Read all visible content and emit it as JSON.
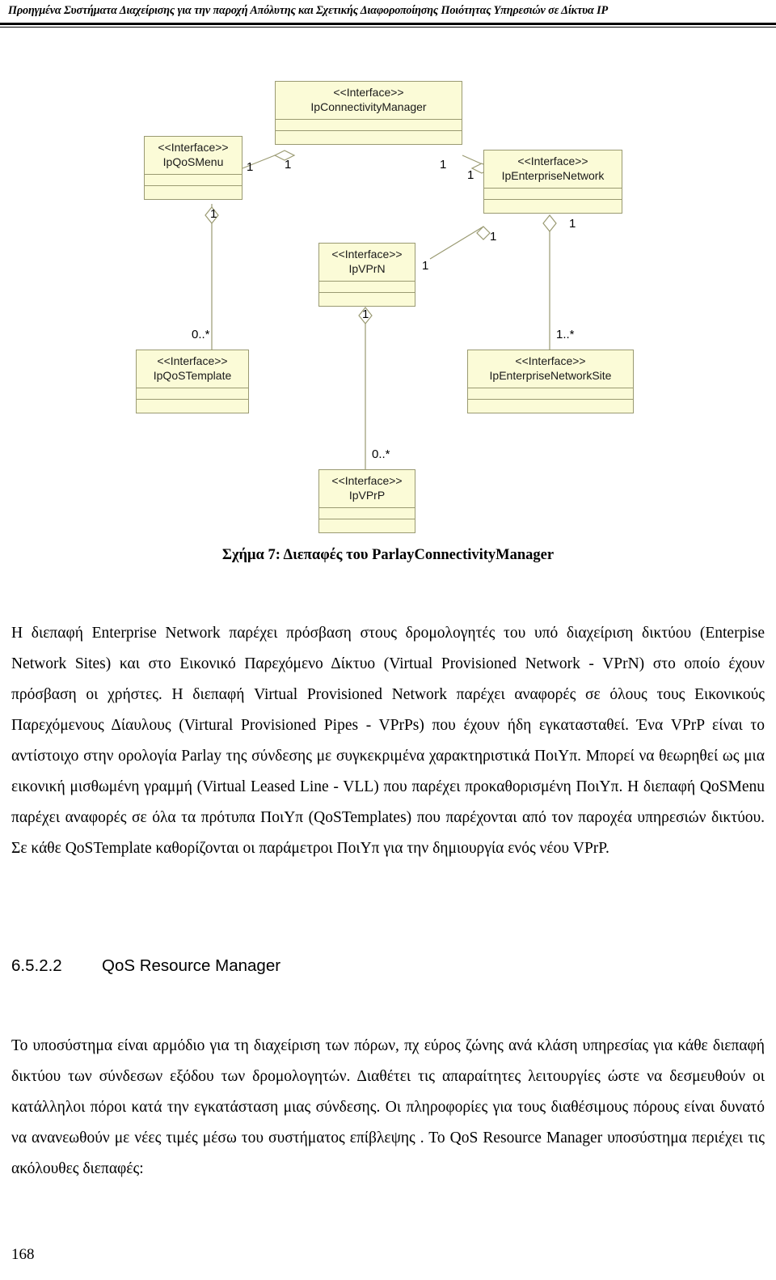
{
  "header": {
    "running_title": "Προηγμένα Συστήματα Διαχείρισης για την παροχή Απόλυτης και Σχετικής Διαφοροποίησης Ποιότητας Υπηρεσιών σε Δίκτυα IP"
  },
  "diagram": {
    "classes": [
      {
        "id": "ipconnectivitymanager",
        "stereotype": "<<Interface>>",
        "name": "IpConnectivityManager"
      },
      {
        "id": "ipqosmenu",
        "stereotype": "<<Interface>>",
        "name": "IpQoSMenu"
      },
      {
        "id": "ipenterprisenetwork",
        "stereotype": "<<Interface>>",
        "name": "IpEnterpriseNetwork"
      },
      {
        "id": "ipvprn",
        "stereotype": "<<Interface>>",
        "name": "IpVPrN"
      },
      {
        "id": "ipqostemplate",
        "stereotype": "<<Interface>>",
        "name": "IpQoSTemplate"
      },
      {
        "id": "ipenterprisenetworksite",
        "stereotype": "<<Interface>>",
        "name": "IpEnterpriseNetworkSite"
      },
      {
        "id": "ipvprp",
        "stereotype": "<<Interface>>",
        "name": "IpVPrP"
      }
    ],
    "multiplicities": [
      {
        "id": "m-qosmenu-right",
        "value": "1"
      },
      {
        "id": "m-connmgr-left",
        "value": "1"
      },
      {
        "id": "m-connmgr-right",
        "value": "1"
      },
      {
        "id": "m-entnet-left",
        "value": "1"
      },
      {
        "id": "m-qosmenu-bottom",
        "value": "1"
      },
      {
        "id": "m-entnet-below-left",
        "value": "1"
      },
      {
        "id": "m-entnet-below-right",
        "value": "1"
      },
      {
        "id": "m-vprn-right",
        "value": "1"
      },
      {
        "id": "m-vprn-bottom",
        "value": "1"
      },
      {
        "id": "m-qostemplate-top",
        "value": "0..*"
      },
      {
        "id": "m-entnetsite-top",
        "value": "1..*"
      },
      {
        "id": "m-vprp-top",
        "value": "0..*"
      }
    ]
  },
  "figure": {
    "caption": "Σχήμα 7: Διεπαφές του ParlayConnectivityManager"
  },
  "paragraphs": {
    "p1": "Η διεπαφή Enterprise Network παρέχει πρόσβαση στους δρομολογητές του υπό διαχείριση δικτύου (Enterpise Network Sites) και στο Εικονικό Παρεχόμενο Δίκτυο (Virtual Provisioned Network - VPrN) στο οποίο έχουν πρόσβαση οι χρήστες. Η διεπαφή Virtual Provisioned Network παρέχει αναφορές σε όλους τους Εικονικούς Παρεχόμενους Δίαυλους (Virtural Provisioned Pipes - VPrPs) που έχουν ήδη εγκατασταθεί. Ένα VPrP είναι το αντίστοιχο στην ορολογία Parlay της σύνδεσης με συγκεκριμένα χαρακτηριστικά ΠοιΥπ.  Μπορεί να θεωρηθεί ως μια εικονική μισθωμένη γραμμή (Virtual Leased Line - VLL) που παρέχει προκαθορισμένη ΠοιΥπ.  Η διεπαφή QoSMenu παρέχει αναφορές σε όλα τα πρότυπα ΠοιΥπ (QoSTemplates) που παρέχονται από τον παροχέα υπηρεσιών δικτύου. Σε κάθε QoSTemplate καθορίζονται οι παράμετροι ΠοιΥπ για την δημιουργία ενός νέου VPrP.",
    "p2": "Το υποσύστημα είναι αρμόδιο για τη διαχείριση των πόρων, πχ εύρος ζώνης ανά κλάση υπηρεσίας για κάθε διεπαφή δικτύου των σύνδεσων εξόδου των δρομολογητών. Διαθέτει τις απαραίτητες λειτουργίες ώστε να δεσμευθούν οι κατάλληλοι πόροι κατά την εγκατάσταση μιας σύνδεσης. Οι πληροφορίες για τους διαθέσιμους πόρους είναι δυνατό να ανανεωθούν με νέες τιμές μέσω του συστήματος επίβλεψης . Το QoS Resource Manager υποσύστημα περιέχει τις ακόλουθες διεπαφές:"
  },
  "section": {
    "number": "6.5.2.2",
    "title": "QoS Resource Manager"
  },
  "footer": {
    "page_number": "168"
  }
}
